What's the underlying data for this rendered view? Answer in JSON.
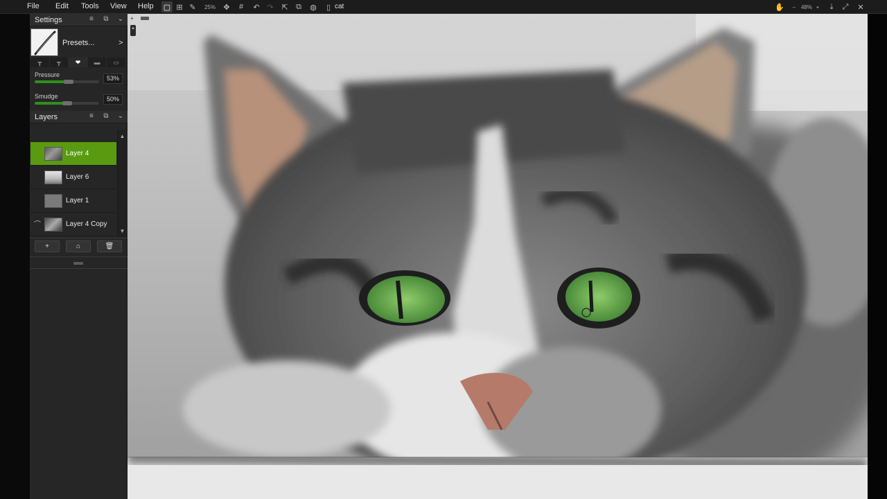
{
  "menu": {
    "file": "File",
    "edit": "Edit",
    "tools": "Tools",
    "view": "View",
    "help": "Help"
  },
  "toolbar": {
    "brush_size": "25%",
    "document_name": "cat",
    "zoom": "48%",
    "zoom_minus": "–",
    "zoom_plus": "+"
  },
  "icons": {
    "canvas_single": "canvas-single-icon",
    "canvas_grid": "canvas-grid-icon",
    "pen": "pen-icon",
    "transform": "transform-icon",
    "grid": "grid-icon",
    "undo": "undo-icon",
    "redo": "redo-icon",
    "export": "export-icon",
    "gallery": "gallery-icon",
    "globe": "globe-icon",
    "document": "document-icon",
    "hand": "hand-icon",
    "download": "download-icon",
    "fullscreen": "fullscreen-icon",
    "close": "close-icon"
  },
  "settings": {
    "title": "Settings",
    "presets": "Presets...",
    "presets_arrow": ">",
    "pressure_label": "Pressure",
    "pressure_value": "53%",
    "pressure_level": 0.53,
    "smudge_label": "Smudge",
    "smudge_value": "50%",
    "smudge_level": 0.5
  },
  "layers": {
    "title": "Layers",
    "items": [
      {
        "name": "Layer 4",
        "selected": true
      },
      {
        "name": "Layer 6",
        "selected": false
      },
      {
        "name": "Layer 1",
        "selected": false
      },
      {
        "name": "Layer 4 Copy",
        "selected": false
      }
    ],
    "add_label": "+",
    "up_arrow": "▲",
    "down_arrow": "▼"
  },
  "colors": {
    "accent": "#5a9a10",
    "slider_fill": "#2f8f1b",
    "panel": "#262626",
    "topbar": "#1c1c1c"
  }
}
